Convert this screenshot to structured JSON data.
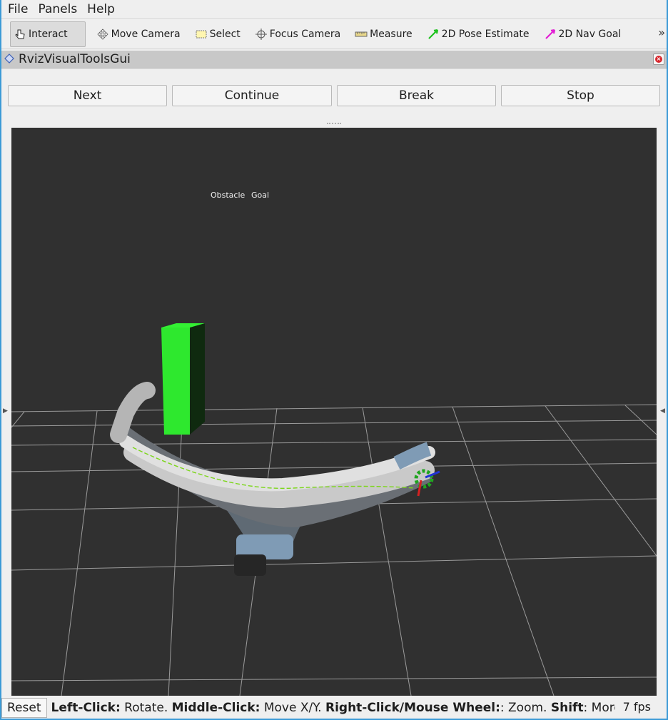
{
  "menu": {
    "file": "File",
    "panels": "Panels",
    "help": "Help"
  },
  "toolbar": {
    "tools": [
      {
        "label": "Interact",
        "icon": "hand-pointer-icon",
        "active": true
      },
      {
        "label": "Move Camera",
        "icon": "move-camera-icon"
      },
      {
        "label": "Select",
        "icon": "select-rectangle-icon"
      },
      {
        "label": "Focus Camera",
        "icon": "crosshair-icon"
      },
      {
        "label": "Measure",
        "icon": "ruler-icon"
      },
      {
        "label": "2D Pose Estimate",
        "icon": "green-arrow-icon"
      },
      {
        "label": "2D Nav Goal",
        "icon": "magenta-arrow-icon"
      }
    ],
    "overflow": "»"
  },
  "panel": {
    "title": "RvizVisualToolsGui",
    "buttons": [
      "Next",
      "Continue",
      "Break",
      "Stop"
    ]
  },
  "viewport": {
    "labels": {
      "obstacle": "Obstacle",
      "goal": "Goal"
    },
    "colors": {
      "background": "#303030",
      "grid": "#a0a0a0",
      "obstacle": "#2ee82e",
      "robot_gray": "#b8b8b8",
      "robot_blue": "#7f9bb5"
    }
  },
  "status": {
    "reset": "Reset",
    "hint_parts": [
      {
        "bold": "Left-Click:",
        "text": " Rotate. "
      },
      {
        "bold": "Middle-Click:",
        "text": " Move X/Y. "
      },
      {
        "bold": "Right-Click/Mouse Wheel:",
        "text": ": Zoom. "
      },
      {
        "bold": "Shift",
        "text": ": More options."
      }
    ],
    "fps": "7 fps"
  }
}
